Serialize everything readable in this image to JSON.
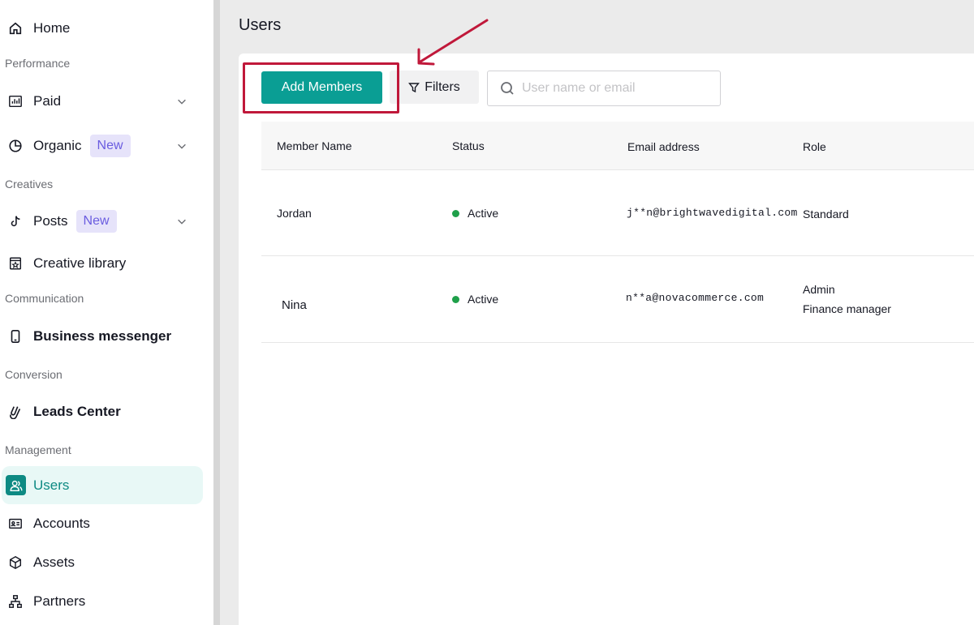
{
  "sidebar": {
    "home": "Home",
    "sections": {
      "performance": "Performance",
      "creatives": "Creatives",
      "communication": "Communication",
      "conversion": "Conversion",
      "management": "Management"
    },
    "paid": "Paid",
    "organic": "Organic",
    "organic_badge": "New",
    "posts": "Posts",
    "posts_badge": "New",
    "creative_library": "Creative library",
    "business_messenger": "Business messenger",
    "leads_center": "Leads Center",
    "users": "Users",
    "accounts": "Accounts",
    "assets": "Assets",
    "partners": "Partners",
    "active_item": "Users"
  },
  "page": {
    "title": "Users"
  },
  "toolbar": {
    "add_members": "Add Members",
    "filters": "Filters",
    "search_placeholder": "User name or email"
  },
  "table": {
    "columns": [
      "Member Name",
      "Status",
      "Email address",
      "Role"
    ],
    "rows": [
      {
        "name": "Jordan",
        "status": "Active",
        "email": "j**n@brightwavedigital.com",
        "roles": [
          "Standard"
        ]
      },
      {
        "name": "Nina",
        "status": "Active",
        "email": "n**a@novacommerce.com",
        "roles": [
          "Admin",
          "Finance manager"
        ]
      }
    ]
  },
  "colors": {
    "accent": "#0a9e94",
    "active_status": "#1fa04a",
    "highlight": "#c0183a",
    "badge_bg": "#e6e3fa",
    "badge_text": "#6a5ce0"
  }
}
